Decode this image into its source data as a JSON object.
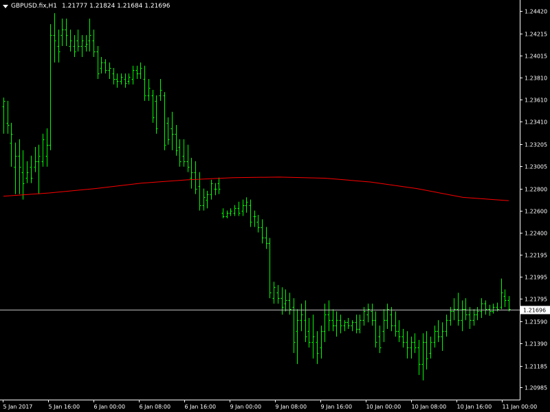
{
  "window": {
    "symbol": "GBPUSD.fix,H1",
    "ohlc": "1.21777 1.21824 1.21684 1.21696"
  },
  "price_tag": "1.21696",
  "colors": {
    "background": "#000000",
    "frame": "#ffffff",
    "bars": "#00ff00",
    "moving_average": "#ff0000",
    "price_line": "#c0c0c0"
  },
  "chart_data": {
    "type": "ohlc",
    "title": "GBPUSD.fix,H1",
    "ylim": [
      1.20875,
      1.2452
    ],
    "y_ticks": [
      "1.24420",
      "1.24215",
      "1.24015",
      "1.23810",
      "1.23610",
      "1.23410",
      "1.23205",
      "1.23005",
      "1.22800",
      "1.22600",
      "1.22400",
      "1.22195",
      "1.21995",
      "1.21795",
      "1.21590",
      "1.21390",
      "1.21185",
      "1.20985"
    ],
    "x_ticks": [
      "5 Jan 2017",
      "5 Jan 16:00",
      "6 Jan 00:00",
      "6 Jan 08:00",
      "6 Jan 16:00",
      "9 Jan 00:00",
      "9 Jan 08:00",
      "9 Jan 16:00",
      "10 Jan 00:00",
      "10 Jan 08:00",
      "10 Jan 16:00",
      "11 Jan 00:00"
    ],
    "current_price": 1.21696,
    "grid": false,
    "bars": [
      {
        "o": 1.2355,
        "h": 1.2363,
        "l": 1.233,
        "c": 1.236
      },
      {
        "o": 1.234,
        "h": 1.236,
        "l": 1.233,
        "c": 1.2338
      },
      {
        "o": 1.2322,
        "h": 1.234,
        "l": 1.23,
        "c": 1.233
      },
      {
        "o": 1.23,
        "h": 1.2322,
        "l": 1.2275,
        "c": 1.231
      },
      {
        "o": 1.231,
        "h": 1.2325,
        "l": 1.2275,
        "c": 1.23
      },
      {
        "o": 1.2295,
        "h": 1.2315,
        "l": 1.227,
        "c": 1.2285
      },
      {
        "o": 1.229,
        "h": 1.2305,
        "l": 1.2285,
        "c": 1.2295
      },
      {
        "o": 1.23,
        "h": 1.231,
        "l": 1.2285,
        "c": 1.229
      },
      {
        "o": 1.23,
        "h": 1.2318,
        "l": 1.2295,
        "c": 1.2305
      },
      {
        "o": 1.2305,
        "h": 1.232,
        "l": 1.2275,
        "c": 1.231
      },
      {
        "o": 1.2305,
        "h": 1.233,
        "l": 1.23,
        "c": 1.2325
      },
      {
        "o": 1.231,
        "h": 1.2335,
        "l": 1.23,
        "c": 1.232
      },
      {
        "o": 1.232,
        "h": 1.243,
        "l": 1.2315,
        "c": 1.242
      },
      {
        "o": 1.242,
        "h": 1.244,
        "l": 1.2395,
        "c": 1.2415
      },
      {
        "o": 1.241,
        "h": 1.2425,
        "l": 1.2395,
        "c": 1.2405
      },
      {
        "o": 1.242,
        "h": 1.2435,
        "l": 1.241,
        "c": 1.2425
      },
      {
        "o": 1.2425,
        "h": 1.2435,
        "l": 1.241,
        "c": 1.242
      },
      {
        "o": 1.241,
        "h": 1.2425,
        "l": 1.2405,
        "c": 1.2415
      },
      {
        "o": 1.241,
        "h": 1.242,
        "l": 1.24,
        "c": 1.2405
      },
      {
        "o": 1.2415,
        "h": 1.2425,
        "l": 1.2405,
        "c": 1.241
      },
      {
        "o": 1.241,
        "h": 1.242,
        "l": 1.24,
        "c": 1.2415
      },
      {
        "o": 1.241,
        "h": 1.242,
        "l": 1.2405,
        "c": 1.2412
      },
      {
        "o": 1.2415,
        "h": 1.2435,
        "l": 1.2405,
        "c": 1.242
      },
      {
        "o": 1.2415,
        "h": 1.2425,
        "l": 1.24,
        "c": 1.2405
      },
      {
        "o": 1.2405,
        "h": 1.241,
        "l": 1.238,
        "c": 1.2385
      },
      {
        "o": 1.239,
        "h": 1.24,
        "l": 1.2385,
        "c": 1.2395
      },
      {
        "o": 1.2395,
        "h": 1.2398,
        "l": 1.2385,
        "c": 1.2388
      },
      {
        "o": 1.2388,
        "h": 1.2395,
        "l": 1.238,
        "c": 1.239
      },
      {
        "o": 1.2385,
        "h": 1.239,
        "l": 1.2375,
        "c": 1.238
      },
      {
        "o": 1.238,
        "h": 1.2385,
        "l": 1.2372,
        "c": 1.2378
      },
      {
        "o": 1.2378,
        "h": 1.2385,
        "l": 1.2375,
        "c": 1.2382
      },
      {
        "o": 1.238,
        "h": 1.2385,
        "l": 1.2372,
        "c": 1.2376
      },
      {
        "o": 1.2378,
        "h": 1.2385,
        "l": 1.2375,
        "c": 1.2382
      },
      {
        "o": 1.238,
        "h": 1.2392,
        "l": 1.2375,
        "c": 1.2388
      },
      {
        "o": 1.2388,
        "h": 1.2392,
        "l": 1.238,
        "c": 1.2385
      },
      {
        "o": 1.2385,
        "h": 1.2395,
        "l": 1.238,
        "c": 1.239
      },
      {
        "o": 1.238,
        "h": 1.2392,
        "l": 1.236,
        "c": 1.2365
      },
      {
        "o": 1.2365,
        "h": 1.238,
        "l": 1.236,
        "c": 1.2372
      },
      {
        "o": 1.2365,
        "h": 1.237,
        "l": 1.234,
        "c": 1.2345
      },
      {
        "o": 1.236,
        "h": 1.2365,
        "l": 1.233,
        "c": 1.2335
      },
      {
        "o": 1.2365,
        "h": 1.238,
        "l": 1.236,
        "c": 1.237
      },
      {
        "o": 1.2365,
        "h": 1.2368,
        "l": 1.2315,
        "c": 1.232
      },
      {
        "o": 1.234,
        "h": 1.2345,
        "l": 1.232,
        "c": 1.2325
      },
      {
        "o": 1.2335,
        "h": 1.235,
        "l": 1.2315,
        "c": 1.233
      },
      {
        "o": 1.233,
        "h": 1.2338,
        "l": 1.231,
        "c": 1.2315
      },
      {
        "o": 1.2318,
        "h": 1.2325,
        "l": 1.23,
        "c": 1.2305
      },
      {
        "o": 1.231,
        "h": 1.2325,
        "l": 1.23,
        "c": 1.2305
      },
      {
        "o": 1.2305,
        "h": 1.232,
        "l": 1.2295,
        "c": 1.23
      },
      {
        "o": 1.229,
        "h": 1.2308,
        "l": 1.228,
        "c": 1.2295
      },
      {
        "o": 1.2295,
        "h": 1.2305,
        "l": 1.2275,
        "c": 1.228
      },
      {
        "o": 1.2282,
        "h": 1.2295,
        "l": 1.226,
        "c": 1.2265
      },
      {
        "o": 1.2265,
        "h": 1.228,
        "l": 1.226,
        "c": 1.2272
      },
      {
        "o": 1.227,
        "h": 1.2278,
        "l": 1.2262,
        "c": 1.2275
      },
      {
        "o": 1.2275,
        "h": 1.2288,
        "l": 1.227,
        "c": 1.2285
      },
      {
        "o": 1.228,
        "h": 1.2285,
        "l": 1.2274,
        "c": 1.228
      },
      {
        "o": 1.2285,
        "h": 1.229,
        "l": 1.2275,
        "c": 1.228
      },
      {
        "o": 1.2258,
        "h": 1.2262,
        "l": 1.2253,
        "c": 1.2255
      },
      {
        "o": 1.2255,
        "h": 1.226,
        "l": 1.2253,
        "c": 1.2258
      },
      {
        "o": 1.2258,
        "h": 1.2262,
        "l": 1.2255,
        "c": 1.226
      },
      {
        "o": 1.2258,
        "h": 1.2265,
        "l": 1.2255,
        "c": 1.2262
      },
      {
        "o": 1.2262,
        "h": 1.2268,
        "l": 1.2255,
        "c": 1.2258
      },
      {
        "o": 1.226,
        "h": 1.227,
        "l": 1.2255,
        "c": 1.2265
      },
      {
        "o": 1.2265,
        "h": 1.2272,
        "l": 1.2258,
        "c": 1.2268
      },
      {
        "o": 1.2265,
        "h": 1.227,
        "l": 1.2245,
        "c": 1.225
      },
      {
        "o": 1.2255,
        "h": 1.226,
        "l": 1.2245,
        "c": 1.2255
      },
      {
        "o": 1.225,
        "h": 1.2256,
        "l": 1.224,
        "c": 1.2245
      },
      {
        "o": 1.2245,
        "h": 1.2252,
        "l": 1.223,
        "c": 1.2235
      },
      {
        "o": 1.2235,
        "h": 1.2245,
        "l": 1.2225,
        "c": 1.223
      },
      {
        "o": 1.223,
        "h": 1.2235,
        "l": 1.218,
        "c": 1.2185
      },
      {
        "o": 1.218,
        "h": 1.2195,
        "l": 1.2175,
        "c": 1.219
      },
      {
        "o": 1.2185,
        "h": 1.2192,
        "l": 1.2175,
        "c": 1.218
      },
      {
        "o": 1.218,
        "h": 1.219,
        "l": 1.2165,
        "c": 1.2172
      },
      {
        "o": 1.2175,
        "h": 1.2188,
        "l": 1.2168,
        "c": 1.2178
      },
      {
        "o": 1.2178,
        "h": 1.2185,
        "l": 1.2165,
        "c": 1.217
      },
      {
        "o": 1.2172,
        "h": 1.218,
        "l": 1.213,
        "c": 1.214
      },
      {
        "o": 1.215,
        "h": 1.217,
        "l": 1.212,
        "c": 1.216
      },
      {
        "o": 1.216,
        "h": 1.2175,
        "l": 1.215,
        "c": 1.2165
      },
      {
        "o": 1.216,
        "h": 1.2178,
        "l": 1.214,
        "c": 1.2145
      },
      {
        "o": 1.215,
        "h": 1.2162,
        "l": 1.2135,
        "c": 1.214
      },
      {
        "o": 1.214,
        "h": 1.2165,
        "l": 1.2125,
        "c": 1.2145
      },
      {
        "o": 1.214,
        "h": 1.215,
        "l": 1.212,
        "c": 1.213
      },
      {
        "o": 1.2135,
        "h": 1.2155,
        "l": 1.2125,
        "c": 1.215
      },
      {
        "o": 1.215,
        "h": 1.2175,
        "l": 1.214,
        "c": 1.2165
      },
      {
        "o": 1.2165,
        "h": 1.2178,
        "l": 1.215,
        "c": 1.216
      },
      {
        "o": 1.216,
        "h": 1.217,
        "l": 1.215,
        "c": 1.2155
      },
      {
        "o": 1.2155,
        "h": 1.2168,
        "l": 1.2145,
        "c": 1.216
      },
      {
        "o": 1.216,
        "h": 1.2165,
        "l": 1.2148,
        "c": 1.2155
      },
      {
        "o": 1.2155,
        "h": 1.216,
        "l": 1.215,
        "c": 1.2158
      },
      {
        "o": 1.2158,
        "h": 1.2162,
        "l": 1.2152,
        "c": 1.2155
      },
      {
        "o": 1.2155,
        "h": 1.216,
        "l": 1.215,
        "c": 1.2158
      },
      {
        "o": 1.2158,
        "h": 1.2165,
        "l": 1.2148,
        "c": 1.2152
      },
      {
        "o": 1.2152,
        "h": 1.2165,
        "l": 1.2148,
        "c": 1.216
      },
      {
        "o": 1.216,
        "h": 1.2172,
        "l": 1.2155,
        "c": 1.2168
      },
      {
        "o": 1.2165,
        "h": 1.2175,
        "l": 1.2158,
        "c": 1.217
      },
      {
        "o": 1.2168,
        "h": 1.2175,
        "l": 1.2155,
        "c": 1.216
      },
      {
        "o": 1.216,
        "h": 1.2168,
        "l": 1.2135,
        "c": 1.214
      },
      {
        "o": 1.2145,
        "h": 1.2155,
        "l": 1.213,
        "c": 1.2135
      },
      {
        "o": 1.215,
        "h": 1.217,
        "l": 1.214,
        "c": 1.216
      },
      {
        "o": 1.216,
        "h": 1.2175,
        "l": 1.2152,
        "c": 1.217
      },
      {
        "o": 1.2165,
        "h": 1.2172,
        "l": 1.215,
        "c": 1.2155
      },
      {
        "o": 1.2155,
        "h": 1.2168,
        "l": 1.2145,
        "c": 1.215
      },
      {
        "o": 1.215,
        "h": 1.216,
        "l": 1.214,
        "c": 1.2145
      },
      {
        "o": 1.2145,
        "h": 1.2152,
        "l": 1.2135,
        "c": 1.214
      },
      {
        "o": 1.214,
        "h": 1.215,
        "l": 1.2125,
        "c": 1.2135
      },
      {
        "o": 1.2135,
        "h": 1.2145,
        "l": 1.2125,
        "c": 1.214
      },
      {
        "o": 1.214,
        "h": 1.2148,
        "l": 1.213,
        "c": 1.2135
      },
      {
        "o": 1.2135,
        "h": 1.2142,
        "l": 1.211,
        "c": 1.212
      },
      {
        "o": 1.212,
        "h": 1.2148,
        "l": 1.2105,
        "c": 1.214
      },
      {
        "o": 1.214,
        "h": 1.215,
        "l": 1.2115,
        "c": 1.2125
      },
      {
        "o": 1.213,
        "h": 1.2145,
        "l": 1.2125,
        "c": 1.214
      },
      {
        "o": 1.214,
        "h": 1.2155,
        "l": 1.2135,
        "c": 1.215
      },
      {
        "o": 1.215,
        "h": 1.216,
        "l": 1.214,
        "c": 1.2145
      },
      {
        "o": 1.2145,
        "h": 1.2158,
        "l": 1.2132,
        "c": 1.215
      },
      {
        "o": 1.215,
        "h": 1.2165,
        "l": 1.2145,
        "c": 1.216
      },
      {
        "o": 1.216,
        "h": 1.2172,
        "l": 1.2155,
        "c": 1.2168
      },
      {
        "o": 1.2168,
        "h": 1.218,
        "l": 1.216,
        "c": 1.217
      },
      {
        "o": 1.217,
        "h": 1.2185,
        "l": 1.2155,
        "c": 1.216
      },
      {
        "o": 1.216,
        "h": 1.2178,
        "l": 1.215,
        "c": 1.217
      },
      {
        "o": 1.217,
        "h": 1.218,
        "l": 1.216,
        "c": 1.2165
      },
      {
        "o": 1.2165,
        "h": 1.2172,
        "l": 1.2152,
        "c": 1.216
      },
      {
        "o": 1.216,
        "h": 1.217,
        "l": 1.2155,
        "c": 1.2165
      },
      {
        "o": 1.2165,
        "h": 1.2172,
        "l": 1.216,
        "c": 1.2168
      },
      {
        "o": 1.2168,
        "h": 1.218,
        "l": 1.2162,
        "c": 1.2175
      },
      {
        "o": 1.2175,
        "h": 1.2178,
        "l": 1.2165,
        "c": 1.217
      },
      {
        "o": 1.217,
        "h": 1.2174,
        "l": 1.2164,
        "c": 1.2168
      },
      {
        "o": 1.2168,
        "h": 1.2175,
        "l": 1.2166,
        "c": 1.2172
      },
      {
        "o": 1.2172,
        "h": 1.2176,
        "l": 1.2168,
        "c": 1.217
      },
      {
        "o": 1.2172,
        "h": 1.2198,
        "l": 1.217,
        "c": 1.2185
      },
      {
        "o": 1.2182,
        "h": 1.2188,
        "l": 1.2172,
        "c": 1.2178
      },
      {
        "o": 1.2178,
        "h": 1.2182,
        "l": 1.2168,
        "c": 1.217
      }
    ],
    "moving_average": [
      1.2273,
      1.2276,
      1.228,
      1.2285,
      1.2288,
      1.229,
      1.22905,
      1.22895,
      1.2286,
      1.228,
      1.2272,
      1.2269
    ]
  }
}
